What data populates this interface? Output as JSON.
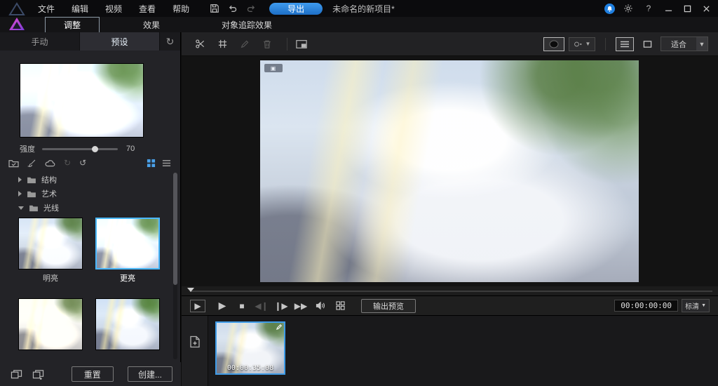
{
  "colors": {
    "accent": "#3f9ce8",
    "export_button": "#2a82d6"
  },
  "titlebar": {
    "menus": [
      "文件",
      "编辑",
      "视频",
      "查看",
      "帮助"
    ],
    "export_label": "导出",
    "project_name": "未命名的新项目*"
  },
  "ribbon": {
    "tabs": [
      {
        "label": "调整",
        "active": true
      },
      {
        "label": "效果",
        "active": false
      },
      {
        "label": "对象追踪效果",
        "active": false
      }
    ]
  },
  "sidebar": {
    "tab_manual": "手动",
    "tab_preset": "预设",
    "intensity": {
      "label": "强度",
      "value": "70"
    },
    "tree": [
      {
        "label": "结构",
        "expanded": false
      },
      {
        "label": "艺术",
        "expanded": false
      },
      {
        "label": "光线",
        "expanded": true
      }
    ],
    "presets": [
      {
        "label": "明亮",
        "selected": false
      },
      {
        "label": "更亮",
        "selected": true
      }
    ],
    "reset_label": "重置",
    "create_label": "创建..."
  },
  "preview": {
    "fit_label": "适合",
    "output_preview_label": "输出预览",
    "timecode": "00:00:00:00",
    "quality_label": "标清"
  },
  "timeline": {
    "clip_time": "00:00:35:08"
  }
}
